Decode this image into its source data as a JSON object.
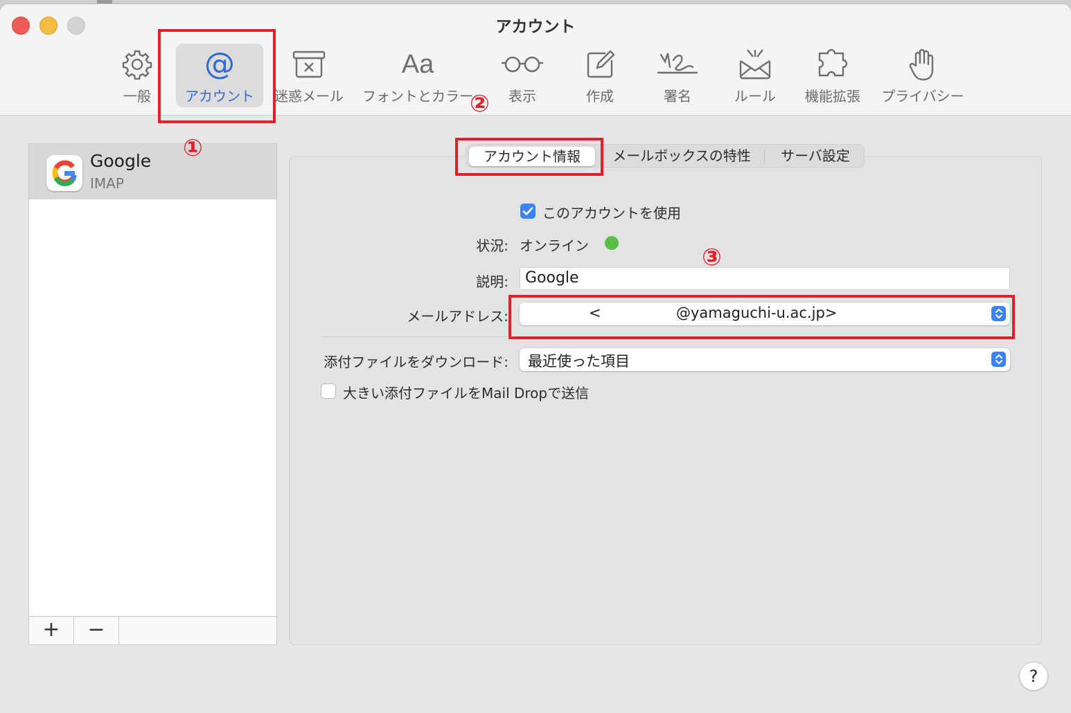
{
  "window": {
    "title": "アカウント"
  },
  "toolbar": {
    "items": [
      {
        "label": "一般",
        "icon": "gear-icon"
      },
      {
        "label": "アカウント",
        "icon": "at-sign-icon"
      },
      {
        "label": "迷惑メール",
        "icon": "junk-trash-icon"
      },
      {
        "label": "フォントとカラー",
        "icon": "font-aa-icon"
      },
      {
        "label": "表示",
        "icon": "glasses-icon"
      },
      {
        "label": "作成",
        "icon": "compose-icon"
      },
      {
        "label": "署名",
        "icon": "signature-icon"
      },
      {
        "label": "ルール",
        "icon": "envelope-rules-icon"
      },
      {
        "label": "機能拡張",
        "icon": "puzzle-icon"
      },
      {
        "label": "プライバシー",
        "icon": "hand-icon"
      }
    ],
    "active": "アカウント"
  },
  "annotations": {
    "one": "①",
    "two": "②",
    "three": "③",
    "color": "#e1202a"
  },
  "accounts": {
    "items": [
      {
        "name": "Google",
        "type": "IMAP"
      }
    ],
    "add_label": "+",
    "remove_label": "−"
  },
  "tabs": {
    "items": [
      "アカウント情報",
      "メールボックスの特性",
      "サーバ設定"
    ],
    "active": "アカウント情報"
  },
  "form": {
    "use_account_label": "このアカウントを使用",
    "use_account_checked": true,
    "status_label": "状況:",
    "status_value": "オンライン",
    "status_color": "#57c043",
    "description_label": "説明:",
    "description_value": "Google",
    "email_label": "メールアドレス:",
    "email_prefix": "<",
    "email_value": "@yamaguchi-u.ac.jp>",
    "download_label": "添付ファイルをダウンロード:",
    "download_value": "最近使った項目",
    "maildrop_label": "大きい添付ファイルをMail Dropで送信",
    "maildrop_checked": false
  },
  "help_label": "?",
  "colors": {
    "accent": "#3a82f7",
    "active_text": "#2e6cd3"
  }
}
